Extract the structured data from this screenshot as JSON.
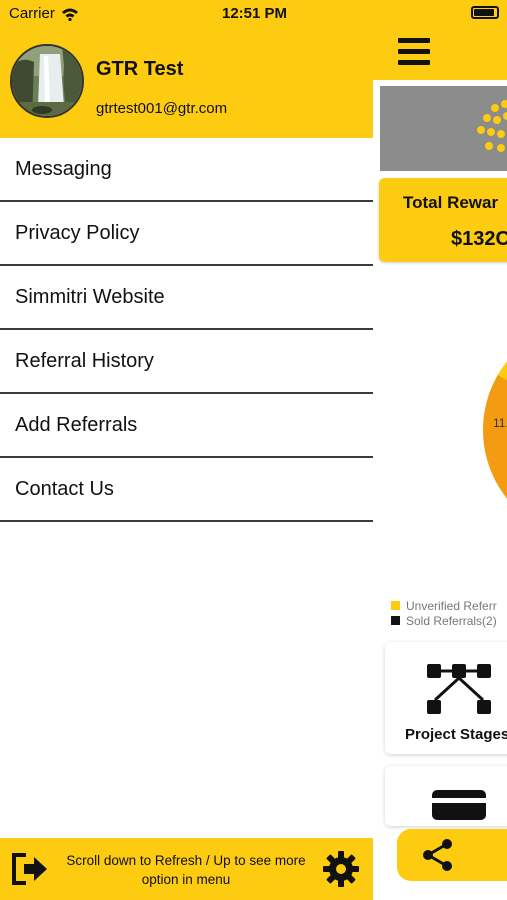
{
  "status_bar": {
    "carrier": "Carrier",
    "time": "12:51 PM"
  },
  "drawer": {
    "user": {
      "name": "GTR Test",
      "email": "gtrtest001@gtr.com"
    },
    "menu_items": [
      "Messaging",
      "Privacy Policy",
      "Simmitri Website",
      "Referral History",
      "Add Referrals",
      "Contact Us"
    ],
    "footer": {
      "hint_text": "Scroll down to Refresh / Up to see more option in menu"
    }
  },
  "main": {
    "rewards": {
      "title": "Total Rewar",
      "value": "$132C"
    },
    "chart_data": {
      "type": "pie",
      "slice_label": "11.",
      "legend": [
        "Unverified Referr",
        "Sold Referrals(2)"
      ]
    },
    "tiles": [
      {
        "label": "Project Stages"
      }
    ]
  },
  "colors": {
    "brand_yellow": "#FDCB10",
    "accent_orange": "#F39C12",
    "text_dark": "#111111"
  },
  "icons": [
    "wifi-icon",
    "battery-icon",
    "hamburger-icon",
    "project-stages-icon",
    "share-icon",
    "logout-icon",
    "gear-icon"
  ]
}
